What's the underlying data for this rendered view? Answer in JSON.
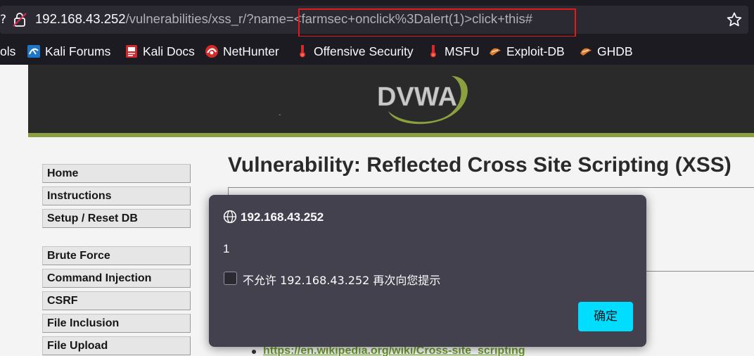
{
  "urlbar": {
    "host": "192.168.43.252",
    "path": "/vulnerabilities/xss_r/?name=",
    "query": "<farmsec+onclick%3Dalert(1)>click+this#",
    "left_glyph": "?",
    "icons": {
      "lock": "insecure-lock-icon",
      "star": "bookmark-star-icon"
    },
    "highlight_color": "#e01a1a"
  },
  "bookmarks": [
    {
      "label": "ols",
      "icon": ""
    },
    {
      "label": "Kali Forums",
      "icon": "kali-forums-icon"
    },
    {
      "label": "Kali Docs",
      "icon": "kali-docs-icon"
    },
    {
      "label": "NetHunter",
      "icon": "nethunter-icon"
    },
    {
      "label": "Offensive Security",
      "icon": "offsec-icon"
    },
    {
      "label": "MSFU",
      "icon": "msfu-icon"
    },
    {
      "label": "Exploit-DB",
      "icon": "exploit-db-icon"
    },
    {
      "label": "GHDB",
      "icon": "ghdb-icon"
    }
  ],
  "site": {
    "logo_text": "DVWA",
    "header_mark": "-",
    "accent": "#8ba03e",
    "menu": [
      "Home",
      "Instructions",
      "Setup / Reset DB",
      "Brute Force",
      "Command Injection",
      "CSRF",
      "File Inclusion",
      "File Upload"
    ],
    "page_title": "Vulnerability: Reflected Cross Site Scripting (XSS)",
    "link": "https://en.wikipedia.org/wiki/Cross-site_scripting"
  },
  "dialog": {
    "origin": "192.168.43.252",
    "message": "1",
    "checkbox_label": "不允许 192.168.43.252 再次向您提示",
    "checkbox_checked": false,
    "ok_label": "确定",
    "ok_color": "#00ddff",
    "icon": "globe-icon"
  }
}
